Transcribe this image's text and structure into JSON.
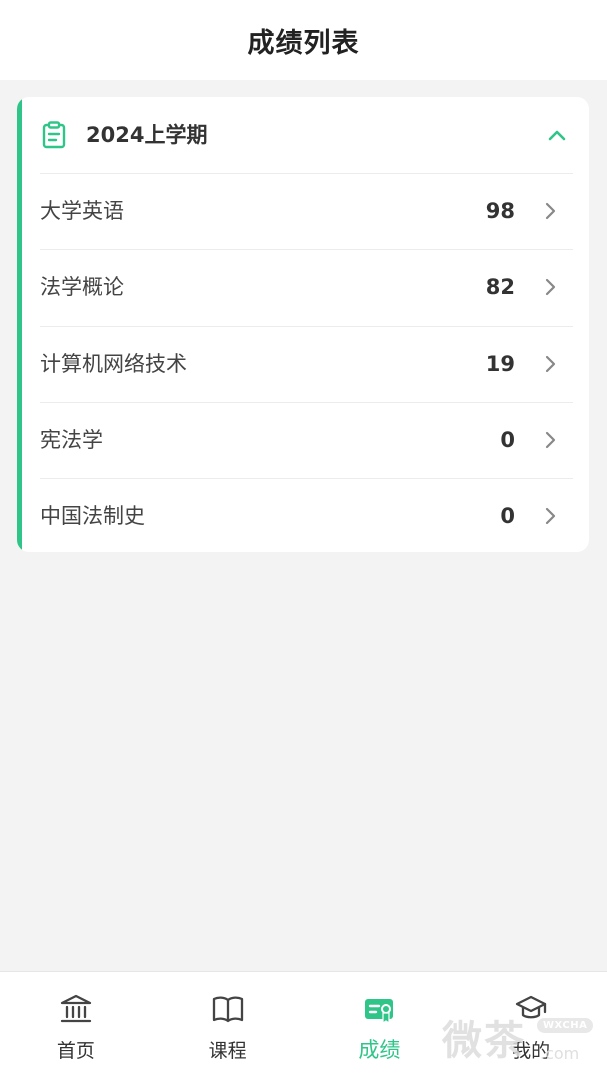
{
  "header": {
    "title": "成绩列表"
  },
  "term": {
    "title": "2024上学期",
    "expanded": true,
    "icon": "clipboard-icon",
    "collapse_icon": "chevron-up-icon"
  },
  "courses": [
    {
      "name": "大学英语",
      "score": "98"
    },
    {
      "name": "法学概论",
      "score": "82"
    },
    {
      "name": "计算机网络技术",
      "score": "19"
    },
    {
      "name": "宪法学",
      "score": "0"
    },
    {
      "name": "中国法制史",
      "score": "0"
    }
  ],
  "bottom_nav": {
    "items": [
      {
        "label": "首页",
        "icon": "bank-icon",
        "active": false
      },
      {
        "label": "课程",
        "icon": "book-icon",
        "active": false
      },
      {
        "label": "成绩",
        "icon": "certificate-icon",
        "active": true
      },
      {
        "label": "我的",
        "icon": "graduation-cap-icon",
        "active": false
      }
    ]
  },
  "watermark": {
    "text": "微茶",
    "badge": "WXCHA",
    "sub": ".com"
  },
  "colors": {
    "accent": "#2fc588",
    "background": "#f3f3f3",
    "card": "#ffffff",
    "text_primary": "#333333"
  }
}
